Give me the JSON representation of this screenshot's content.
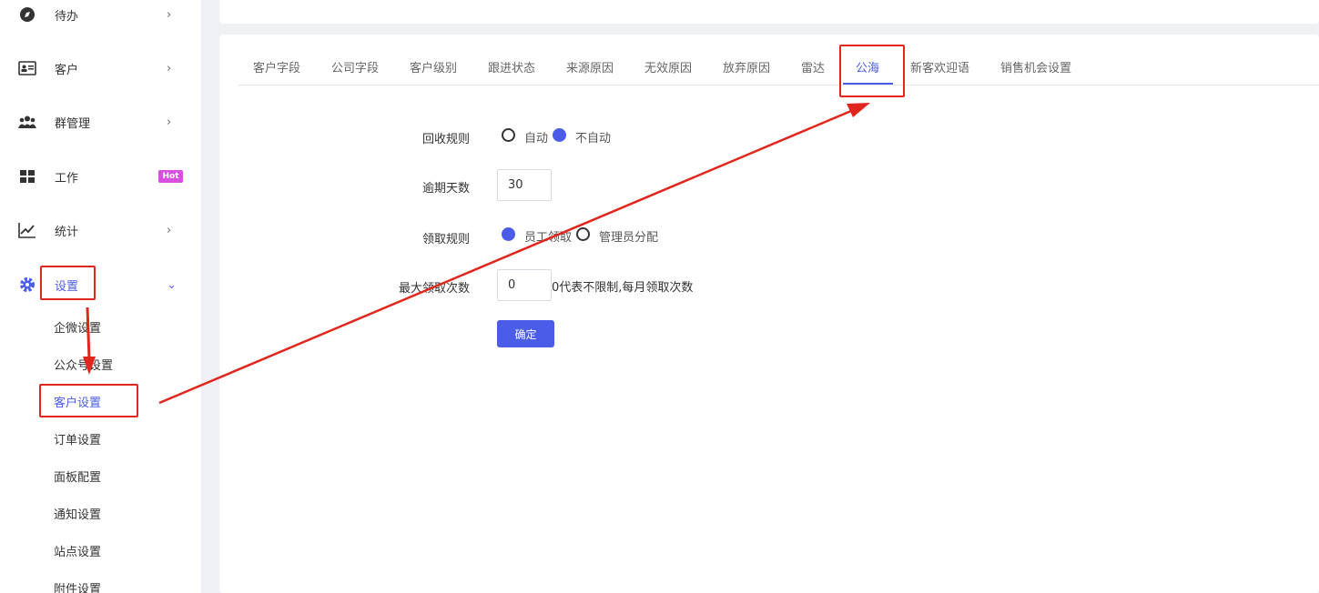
{
  "sidebar": {
    "items": [
      {
        "label": "待办",
        "icon": "compass-icon",
        "chevron": "›"
      },
      {
        "label": "客户",
        "icon": "id-card-icon",
        "chevron": "›"
      },
      {
        "label": "群管理",
        "icon": "users-icon",
        "chevron": "›"
      },
      {
        "label": "工作",
        "icon": "grid-icon",
        "badge": "Hot"
      },
      {
        "label": "统计",
        "icon": "chart-line-icon",
        "chevron": "›"
      },
      {
        "label": "设置",
        "icon": "gear-icon",
        "chevron": "⌄"
      }
    ],
    "sub_items": [
      "企微设置",
      "公众号设置",
      "客户设置",
      "订单设置",
      "面板配置",
      "通知设置",
      "站点设置",
      "附件设置"
    ]
  },
  "tabs": [
    "客户字段",
    "公司字段",
    "客户级别",
    "跟进状态",
    "来源原因",
    "无效原因",
    "放弃原因",
    "雷达",
    "公海",
    "新客欢迎语",
    "销售机会设置"
  ],
  "active_tab": "公海",
  "form": {
    "recycle_label": "回收规则",
    "recycle_options": [
      "自动",
      "不自动"
    ],
    "recycle_selected": "不自动",
    "overdue_label": "逾期天数",
    "overdue_value": "30",
    "claim_label": "领取规则",
    "claim_options": [
      "员工领取",
      "管理员分配"
    ],
    "claim_selected": "员工领取",
    "max_label": "最大领取次数",
    "max_value": "0",
    "max_hint": "0代表不限制,每月领取次数",
    "submit_label": "确定"
  },
  "colors": {
    "accent": "#4a5ce8",
    "annotation": "#e0261d",
    "hot_badge": "#d84fe2"
  }
}
